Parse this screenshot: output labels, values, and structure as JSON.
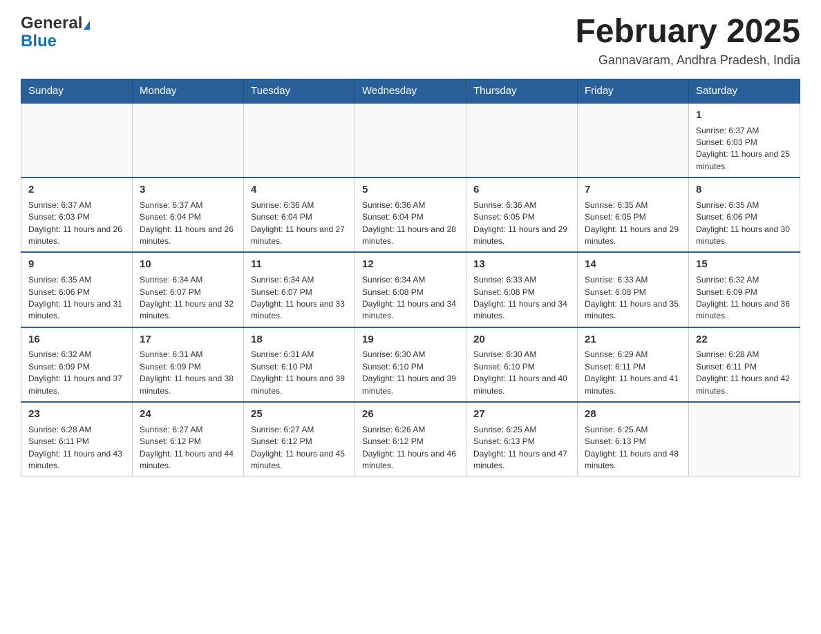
{
  "header": {
    "logo_general": "General",
    "logo_blue": "Blue",
    "month_title": "February 2025",
    "location": "Gannavaram, Andhra Pradesh, India"
  },
  "weekdays": [
    "Sunday",
    "Monday",
    "Tuesday",
    "Wednesday",
    "Thursday",
    "Friday",
    "Saturday"
  ],
  "weeks": [
    [
      {
        "day": "",
        "sunrise": "",
        "sunset": "",
        "daylight": ""
      },
      {
        "day": "",
        "sunrise": "",
        "sunset": "",
        "daylight": ""
      },
      {
        "day": "",
        "sunrise": "",
        "sunset": "",
        "daylight": ""
      },
      {
        "day": "",
        "sunrise": "",
        "sunset": "",
        "daylight": ""
      },
      {
        "day": "",
        "sunrise": "",
        "sunset": "",
        "daylight": ""
      },
      {
        "day": "",
        "sunrise": "",
        "sunset": "",
        "daylight": ""
      },
      {
        "day": "1",
        "sunrise": "Sunrise: 6:37 AM",
        "sunset": "Sunset: 6:03 PM",
        "daylight": "Daylight: 11 hours and 25 minutes."
      }
    ],
    [
      {
        "day": "2",
        "sunrise": "Sunrise: 6:37 AM",
        "sunset": "Sunset: 6:03 PM",
        "daylight": "Daylight: 11 hours and 26 minutes."
      },
      {
        "day": "3",
        "sunrise": "Sunrise: 6:37 AM",
        "sunset": "Sunset: 6:04 PM",
        "daylight": "Daylight: 11 hours and 26 minutes."
      },
      {
        "day": "4",
        "sunrise": "Sunrise: 6:36 AM",
        "sunset": "Sunset: 6:04 PM",
        "daylight": "Daylight: 11 hours and 27 minutes."
      },
      {
        "day": "5",
        "sunrise": "Sunrise: 6:36 AM",
        "sunset": "Sunset: 6:04 PM",
        "daylight": "Daylight: 11 hours and 28 minutes."
      },
      {
        "day": "6",
        "sunrise": "Sunrise: 6:36 AM",
        "sunset": "Sunset: 6:05 PM",
        "daylight": "Daylight: 11 hours and 29 minutes."
      },
      {
        "day": "7",
        "sunrise": "Sunrise: 6:35 AM",
        "sunset": "Sunset: 6:05 PM",
        "daylight": "Daylight: 11 hours and 29 minutes."
      },
      {
        "day": "8",
        "sunrise": "Sunrise: 6:35 AM",
        "sunset": "Sunset: 6:06 PM",
        "daylight": "Daylight: 11 hours and 30 minutes."
      }
    ],
    [
      {
        "day": "9",
        "sunrise": "Sunrise: 6:35 AM",
        "sunset": "Sunset: 6:06 PM",
        "daylight": "Daylight: 11 hours and 31 minutes."
      },
      {
        "day": "10",
        "sunrise": "Sunrise: 6:34 AM",
        "sunset": "Sunset: 6:07 PM",
        "daylight": "Daylight: 11 hours and 32 minutes."
      },
      {
        "day": "11",
        "sunrise": "Sunrise: 6:34 AM",
        "sunset": "Sunset: 6:07 PM",
        "daylight": "Daylight: 11 hours and 33 minutes."
      },
      {
        "day": "12",
        "sunrise": "Sunrise: 6:34 AM",
        "sunset": "Sunset: 6:08 PM",
        "daylight": "Daylight: 11 hours and 34 minutes."
      },
      {
        "day": "13",
        "sunrise": "Sunrise: 6:33 AM",
        "sunset": "Sunset: 6:08 PM",
        "daylight": "Daylight: 11 hours and 34 minutes."
      },
      {
        "day": "14",
        "sunrise": "Sunrise: 6:33 AM",
        "sunset": "Sunset: 6:08 PM",
        "daylight": "Daylight: 11 hours and 35 minutes."
      },
      {
        "day": "15",
        "sunrise": "Sunrise: 6:32 AM",
        "sunset": "Sunset: 6:09 PM",
        "daylight": "Daylight: 11 hours and 36 minutes."
      }
    ],
    [
      {
        "day": "16",
        "sunrise": "Sunrise: 6:32 AM",
        "sunset": "Sunset: 6:09 PM",
        "daylight": "Daylight: 11 hours and 37 minutes."
      },
      {
        "day": "17",
        "sunrise": "Sunrise: 6:31 AM",
        "sunset": "Sunset: 6:09 PM",
        "daylight": "Daylight: 11 hours and 38 minutes."
      },
      {
        "day": "18",
        "sunrise": "Sunrise: 6:31 AM",
        "sunset": "Sunset: 6:10 PM",
        "daylight": "Daylight: 11 hours and 39 minutes."
      },
      {
        "day": "19",
        "sunrise": "Sunrise: 6:30 AM",
        "sunset": "Sunset: 6:10 PM",
        "daylight": "Daylight: 11 hours and 39 minutes."
      },
      {
        "day": "20",
        "sunrise": "Sunrise: 6:30 AM",
        "sunset": "Sunset: 6:10 PM",
        "daylight": "Daylight: 11 hours and 40 minutes."
      },
      {
        "day": "21",
        "sunrise": "Sunrise: 6:29 AM",
        "sunset": "Sunset: 6:11 PM",
        "daylight": "Daylight: 11 hours and 41 minutes."
      },
      {
        "day": "22",
        "sunrise": "Sunrise: 6:28 AM",
        "sunset": "Sunset: 6:11 PM",
        "daylight": "Daylight: 11 hours and 42 minutes."
      }
    ],
    [
      {
        "day": "23",
        "sunrise": "Sunrise: 6:28 AM",
        "sunset": "Sunset: 6:11 PM",
        "daylight": "Daylight: 11 hours and 43 minutes."
      },
      {
        "day": "24",
        "sunrise": "Sunrise: 6:27 AM",
        "sunset": "Sunset: 6:12 PM",
        "daylight": "Daylight: 11 hours and 44 minutes."
      },
      {
        "day": "25",
        "sunrise": "Sunrise: 6:27 AM",
        "sunset": "Sunset: 6:12 PM",
        "daylight": "Daylight: 11 hours and 45 minutes."
      },
      {
        "day": "26",
        "sunrise": "Sunrise: 6:26 AM",
        "sunset": "Sunset: 6:12 PM",
        "daylight": "Daylight: 11 hours and 46 minutes."
      },
      {
        "day": "27",
        "sunrise": "Sunrise: 6:25 AM",
        "sunset": "Sunset: 6:13 PM",
        "daylight": "Daylight: 11 hours and 47 minutes."
      },
      {
        "day": "28",
        "sunrise": "Sunrise: 6:25 AM",
        "sunset": "Sunset: 6:13 PM",
        "daylight": "Daylight: 11 hours and 48 minutes."
      },
      {
        "day": "",
        "sunrise": "",
        "sunset": "",
        "daylight": ""
      }
    ]
  ]
}
